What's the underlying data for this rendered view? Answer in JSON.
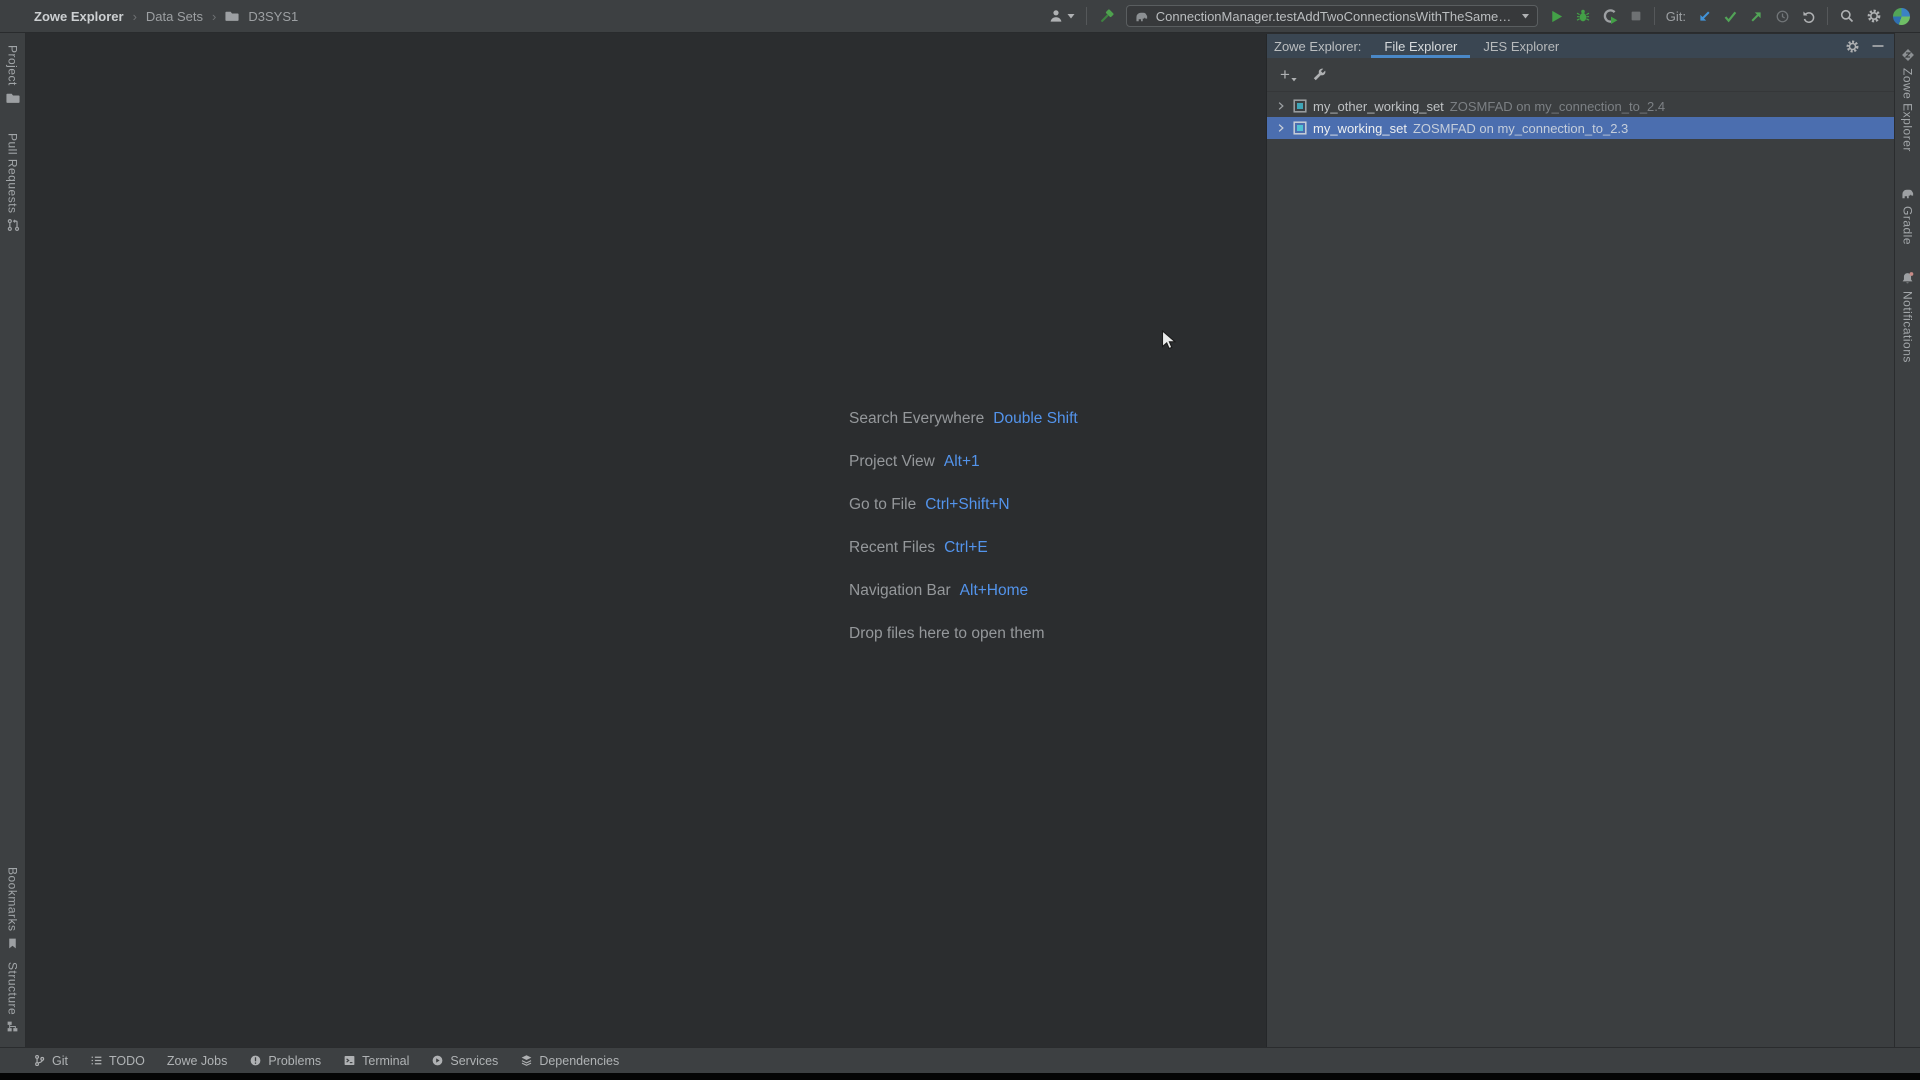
{
  "colors": {
    "accent_blue": "#4A88C7",
    "selection_blue": "#4B6EAF",
    "shortcut_key_blue": "#5394EC",
    "run_green": "#43A047",
    "vcs_green": "#52A457",
    "git_update_blue": "#4193D9",
    "working_set_teal": "#3FA6B8",
    "notification_dot_red": "#C75450"
  },
  "breadcrumb": {
    "separator": "›",
    "root": "Zowe Explorer",
    "section": "Data Sets",
    "leaf": "D3SYS1"
  },
  "toolbar": {
    "run_config": "ConnectionManager.testAddTwoConnectionsWithTheSameName",
    "git_label": "Git:"
  },
  "left_stripe": {
    "top": [
      {
        "label": "Project"
      },
      {
        "label": "Pull Requests"
      }
    ],
    "bottom": [
      {
        "label": "Bookmarks"
      },
      {
        "label": "Structure"
      }
    ]
  },
  "right_stripe": [
    {
      "label": "Zowe Explorer"
    },
    {
      "label": "Gradle"
    },
    {
      "label": "Notifications"
    }
  ],
  "panel": {
    "title": "Zowe Explorer:",
    "tabs": [
      {
        "label": "File Explorer"
      },
      {
        "label": "JES Explorer"
      }
    ],
    "toolbar": {
      "add_glyph": "+"
    },
    "tree": [
      {
        "name": "my_other_working_set",
        "detail": "ZOSMFAD on my_connection_to_2.4"
      },
      {
        "name": "my_working_set",
        "detail": "ZOSMFAD on my_connection_to_2.3"
      }
    ]
  },
  "editor_shortcuts": {
    "rows": [
      {
        "label": "Search Everywhere",
        "key": "Double Shift"
      },
      {
        "label": "Project View",
        "key": "Alt+1"
      },
      {
        "label": "Go to File",
        "key": "Ctrl+Shift+N"
      },
      {
        "label": "Recent Files",
        "key": "Ctrl+E"
      },
      {
        "label": "Navigation Bar",
        "key": "Alt+Home"
      }
    ],
    "drop_hint": "Drop files here to open them"
  },
  "bottom_bar": {
    "items": [
      {
        "label": "Git"
      },
      {
        "label": "TODO"
      },
      {
        "label": "Zowe Jobs"
      },
      {
        "label": "Problems"
      },
      {
        "label": "Terminal"
      },
      {
        "label": "Services"
      },
      {
        "label": "Dependencies"
      }
    ]
  }
}
